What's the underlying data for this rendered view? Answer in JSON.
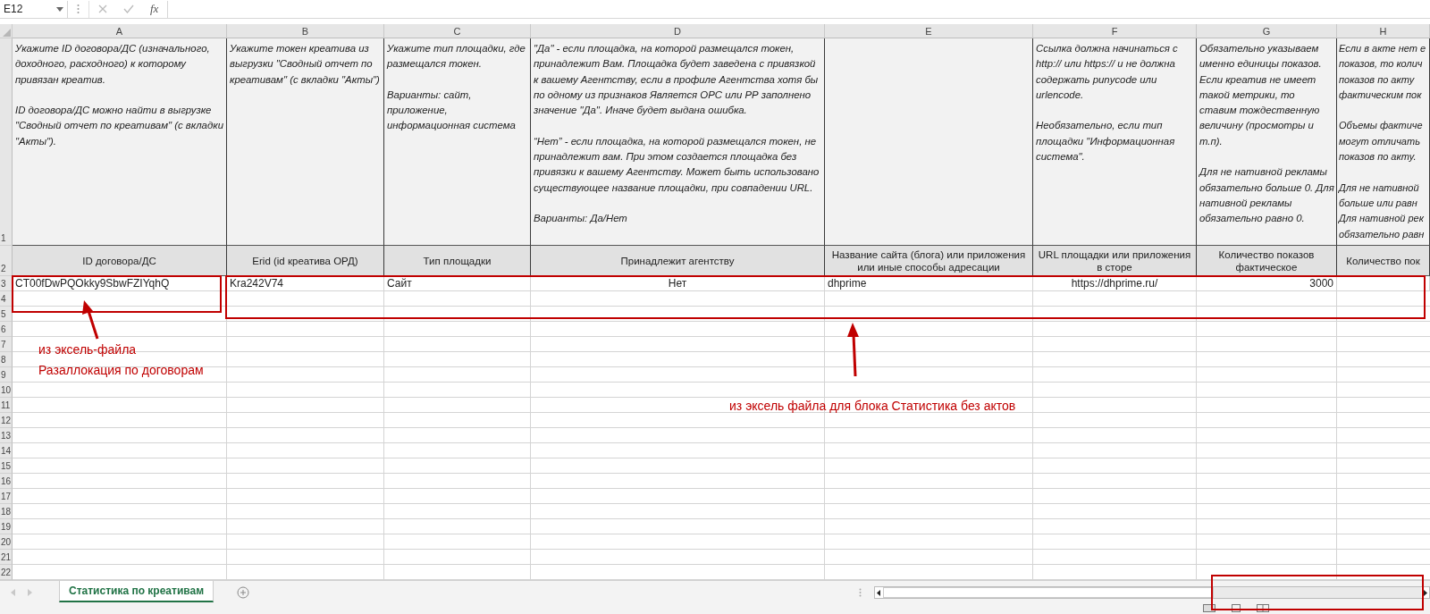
{
  "formula_bar": {
    "name_box": "E12",
    "function_label": "fx"
  },
  "columns": [
    {
      "letter": "A",
      "note": "Укажите ID договора/ДС (изначального, доходного, расходного) к которому привязан креатив.\n\nID договора/ДС можно найти в выгрузке \"Сводный отчет по креативам\" (с вкладки \"Акты\").",
      "header": "ID договора/ДС",
      "cell": "CT00fDwPQOkky9SbwFZIYqhQ"
    },
    {
      "letter": "B",
      "note": "Укажите токен креатива из выгрузки \"Сводный отчет по креативам\" (с вкладки \"Акты\")",
      "header": "Erid (id креатива ОРД)",
      "cell": "Kra242V74"
    },
    {
      "letter": "C",
      "note": "Укажите тип площадки, где размещался токен.\n\nВарианты: сайт, приложение, информационная система",
      "header": "Тип площадки",
      "cell": "Сайт"
    },
    {
      "letter": "D",
      "note": "\"Да\" - если площадка, на которой размещался токен, принадлежит Вам. Площадка будет заведена с привязкой к вашему Агентству, если в профиле Агентства хотя бы по одному из признаков Является ОРС или РР заполнено значение \"Да\". Иначе будет выдана ошибка.\n\n“Нет” - если площадка, на которой размещался токен, не принадлежит вам. При этом создается площадка без привязки к вашему Агентству. Может быть использовано существующее название площадки, при совпадении URL.\n\nВарианты: Да/Нет",
      "header": "Принадлежит агентству",
      "cell": "Нет"
    },
    {
      "letter": "E",
      "header": "Название сайта (блога) или приложения или иные способы адресации",
      "cell": "dhprime"
    },
    {
      "letter": "F",
      "note": "Ссылка должна начинаться с http:// или https:// и не должна содержать punycode или urlencode.\n\nНеобязательно, если тип площадки \"Информационная система\".",
      "header": "URL площадки или приложения в сторе",
      "cell": "https://dhprime.ru/"
    },
    {
      "letter": "G",
      "note": "Обязательно указываем именно единицы показов. Если креатив не имеет такой метрики, то ставим тождественную величину (просмотры и т.п).\n\nДля не нативной рекламы обязательно больше 0. Для нативной рекламы обязательно равно 0.",
      "header": "Количество показов фактическое",
      "cell": "3000"
    },
    {
      "letter": "H",
      "note": "Если в акте нет е\nпоказов, то колич\nпоказов по акту\nфактическим пок\n\nОбъемы фактиче\nмогут отличать\nпоказов по акту.\n\nДля не нативной\nбольше или равн\nДля нативной рек\nобязательно равн",
      "header": "Количество пок"
    }
  ],
  "row_numbers": [
    "1",
    "2",
    "3",
    "4",
    "5",
    "6",
    "7",
    "8",
    "9",
    "10",
    "11",
    "12",
    "13",
    "14",
    "15",
    "16",
    "17",
    "18",
    "19",
    "20",
    "21",
    "22"
  ],
  "annotations": [
    {
      "text": "из эксель-файла\nРазаллокация по договорам"
    },
    {
      "text": "из эксель файла для блока Статистика без актов"
    }
  ],
  "sheet_tabs": [
    {
      "label": "Статистика по креативам",
      "selected": true
    }
  ]
}
